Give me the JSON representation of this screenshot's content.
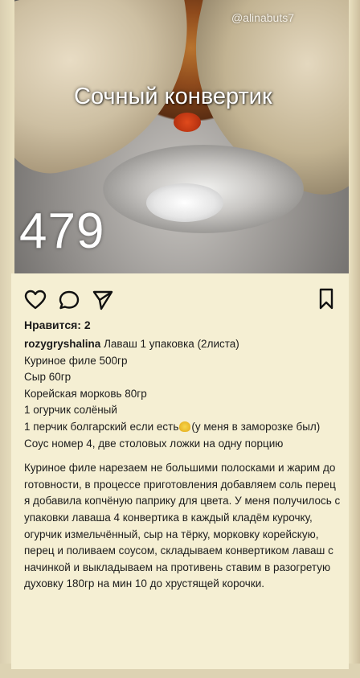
{
  "photo": {
    "watermark": "@alinabuts7",
    "title": "Сочный конвертик",
    "number": "479"
  },
  "post": {
    "likes": "Нравится: 2",
    "username": "rozygryshalina",
    "lines": [
      "Лаваш 1 упаковка (2листа)",
      "Куриное филе 500гр",
      "Сыр 60гр",
      "Корейская морковь 80гр",
      "1 огурчик солёный",
      "1 перчик болгарский если есть",
      "(у меня в заморозке был)",
      "Соус номер 4, две столовых ложки на одну порцию"
    ],
    "method": "Куриное филе нарезаем не большими полосками и жарим до готовности, в процессе приготовления добавляем соль перец я добавила копчёную паприку для цвета. У меня получилось с упаковки лаваша 4 конвертика в каждый кладём курочку, огурчик измельчённый, сыр на тёрку, морковку корейскую, перец и поливаем соусом, складываем конвертиком лаваш с начинкой и выкладываем на противень ставим в разогретую духовку 180гр на мин 10 до хрустящей корочки."
  },
  "icons": {
    "like": "heart-icon",
    "comment": "comment-icon",
    "share": "send-icon",
    "save": "bookmark-icon",
    "emoji": "hands-emoji"
  }
}
